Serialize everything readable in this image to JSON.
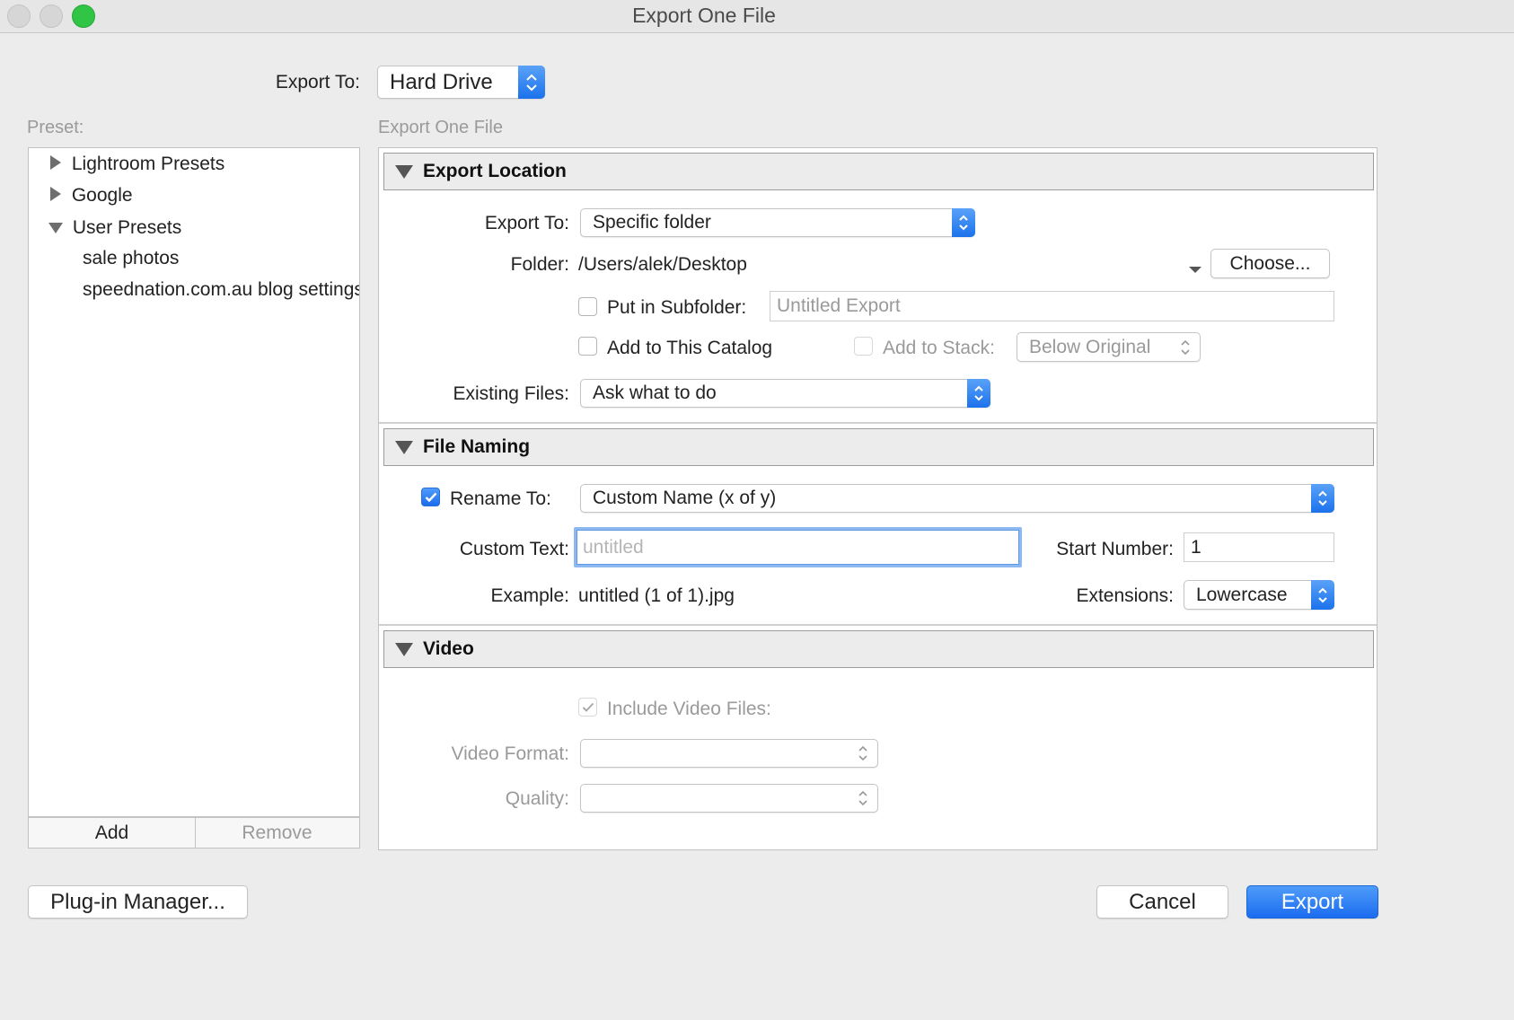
{
  "window": {
    "title": "Export One File"
  },
  "top": {
    "export_to_label": "Export To:",
    "export_to_value": "Hard Drive"
  },
  "presets": {
    "header": "Preset:",
    "items": [
      {
        "label": "Lightroom Presets",
        "expanded": false
      },
      {
        "label": "Google",
        "expanded": false
      },
      {
        "label": "User Presets",
        "expanded": true
      },
      {
        "label": "sale photos"
      },
      {
        "label": "speednation.com.au blog settings"
      }
    ],
    "add_label": "Add",
    "remove_label": "Remove"
  },
  "main": {
    "header": "Export One File",
    "export_location": {
      "title": "Export Location",
      "export_to_label": "Export To:",
      "export_to_value": "Specific folder",
      "folder_label": "Folder:",
      "folder_value": "/Users/alek/Desktop",
      "choose_label": "Choose...",
      "subfolder_label": "Put in Subfolder:",
      "subfolder_checked": false,
      "subfolder_placeholder": "Untitled Export",
      "add_catalog_label": "Add to This Catalog",
      "add_catalog_checked": false,
      "add_stack_label": "Add to Stack:",
      "add_stack_value": "Below Original",
      "existing_label": "Existing Files:",
      "existing_value": "Ask what to do"
    },
    "file_naming": {
      "title": "File Naming",
      "rename_label": "Rename To:",
      "rename_checked": true,
      "rename_value": "Custom Name (x of y)",
      "custom_text_label": "Custom Text:",
      "custom_text_placeholder": "untitled",
      "start_number_label": "Start Number:",
      "start_number_value": "1",
      "example_label": "Example:",
      "example_value": "untitled (1 of 1).jpg",
      "extensions_label": "Extensions:",
      "extensions_value": "Lowercase"
    },
    "video": {
      "title": "Video",
      "include_label": "Include Video Files:",
      "include_checked": true,
      "format_label": "Video Format:",
      "quality_label": "Quality:"
    }
  },
  "footer": {
    "plugin_label": "Plug-in Manager...",
    "cancel_label": "Cancel",
    "export_label": "Export"
  },
  "colors": {
    "accent": "#1b6cf0",
    "window_bg": "#ececec"
  }
}
